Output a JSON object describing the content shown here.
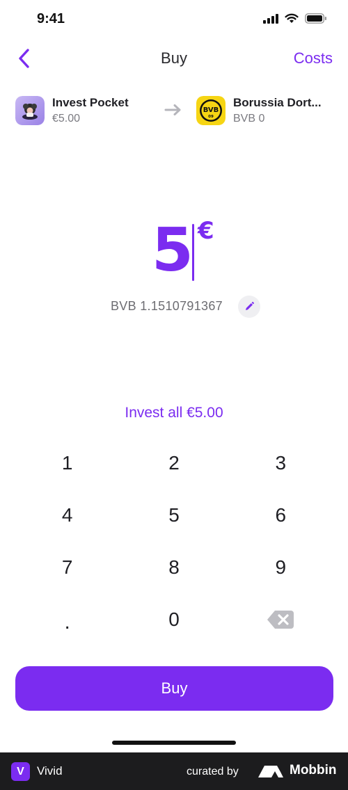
{
  "status_bar": {
    "time": "9:41"
  },
  "nav": {
    "title": "Buy",
    "costs_label": "Costs"
  },
  "transfer": {
    "from": {
      "name": "Invest Pocket",
      "value": "€5.00"
    },
    "to": {
      "name": "Borussia Dort...",
      "value": "BVB 0",
      "logo_text": "BVB",
      "logo_sub": "09"
    }
  },
  "amount": {
    "value": "5",
    "currency": "€"
  },
  "conversion": {
    "text": "BVB 1.1510791367"
  },
  "invest_all_label": "Invest all €5.00",
  "keypad": {
    "keys": [
      "1",
      "2",
      "3",
      "4",
      "5",
      "6",
      "7",
      "8",
      "9",
      ".",
      "0"
    ]
  },
  "buy_label": "Buy",
  "footer": {
    "app_name": "Vivid",
    "app_badge": "V",
    "curated_by": "curated by",
    "brand": "Mobbin"
  },
  "colors": {
    "accent": "#7b2cf0",
    "bvb_yellow": "#f6d514"
  }
}
